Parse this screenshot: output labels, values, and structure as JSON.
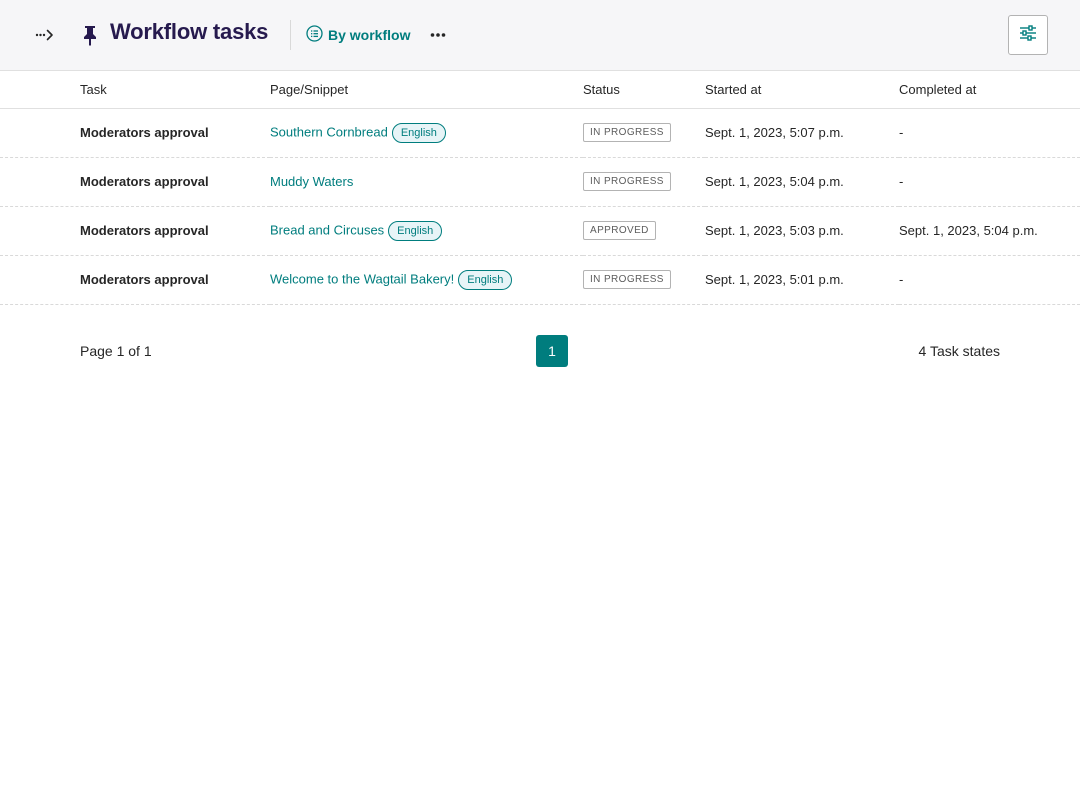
{
  "header": {
    "title": "Workflow tasks",
    "view_toggle_label": "By workflow",
    "icons": {
      "breadcrumb": "breadcrumb-expand-icon",
      "pin": "pin-icon",
      "view": "list-icon",
      "more": "more-dots-icon",
      "filter": "filter-sliders-icon"
    }
  },
  "table": {
    "columns": [
      "Task",
      "Page/Snippet",
      "Status",
      "Started at",
      "Completed at"
    ],
    "rows": [
      {
        "task": "Moderators approval",
        "page": "Southern Cornbread",
        "locale": "English",
        "status": "IN PROGRESS",
        "started": "Sept. 1, 2023, 5:07 p.m.",
        "completed": "-"
      },
      {
        "task": "Moderators approval",
        "page": "Muddy Waters",
        "locale": "",
        "status": "IN PROGRESS",
        "started": "Sept. 1, 2023, 5:04 p.m.",
        "completed": "-"
      },
      {
        "task": "Moderators approval",
        "page": "Bread and Circuses",
        "locale": "English",
        "status": "APPROVED",
        "started": "Sept. 1, 2023, 5:03 p.m.",
        "completed": "Sept. 1, 2023, 5:04 p.m."
      },
      {
        "task": "Moderators approval",
        "page": "Welcome to the Wagtail Bakery!",
        "locale": "English",
        "status": "IN PROGRESS",
        "started": "Sept. 1, 2023, 5:01 p.m.",
        "completed": "-"
      }
    ]
  },
  "pagination": {
    "info": "Page 1 of 1",
    "current_page": "1",
    "count": "4 Task states"
  },
  "colors": {
    "accent": "#007d7e",
    "title": "#261a4e",
    "header_bg": "#f6f6f8"
  }
}
